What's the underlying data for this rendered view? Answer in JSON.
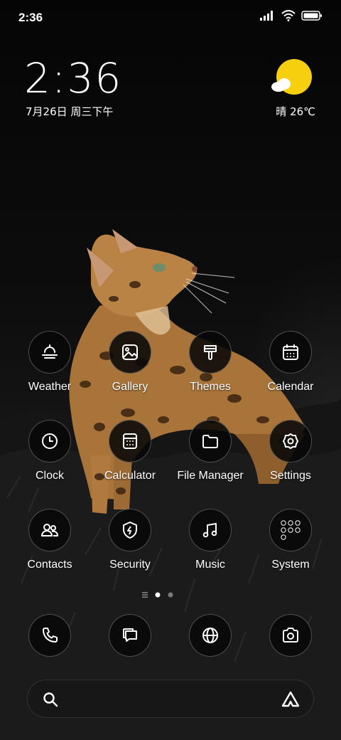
{
  "status_bar": {
    "time": "2:36",
    "icons": [
      "signal-icon",
      "wifi-icon",
      "battery-icon"
    ]
  },
  "clock_widget": {
    "time": "2:36",
    "date": "7月26日 周三下午"
  },
  "weather_widget": {
    "condition": "晴",
    "temperature": "26℃",
    "icon": "sun-cloud-icon"
  },
  "apps": [
    {
      "label": "Weather",
      "icon": "weather-icon"
    },
    {
      "label": "Gallery",
      "icon": "gallery-icon"
    },
    {
      "label": "Themes",
      "icon": "themes-brush-icon"
    },
    {
      "label": "Calendar",
      "icon": "calendar-icon"
    },
    {
      "label": "Clock",
      "icon": "clock-icon"
    },
    {
      "label": "Calculator",
      "icon": "calculator-icon"
    },
    {
      "label": "File Manager",
      "icon": "folder-icon"
    },
    {
      "label": "Settings",
      "icon": "gear-icon"
    },
    {
      "label": "Contacts",
      "icon": "contacts-icon"
    },
    {
      "label": "Security",
      "icon": "shield-icon"
    },
    {
      "label": "Music",
      "icon": "music-note-icon"
    },
    {
      "label": "System",
      "icon": "folder-grid-icon"
    }
  ],
  "page_indicator": {
    "pages": 2,
    "current": 1
  },
  "dock": [
    {
      "name": "phone",
      "icon": "phone-icon"
    },
    {
      "name": "messages",
      "icon": "message-icon"
    },
    {
      "name": "browser",
      "icon": "globe-icon"
    },
    {
      "name": "camera",
      "icon": "camera-icon"
    }
  ],
  "search_bar": {
    "left_icon": "search-icon",
    "right_icon": "assistant-icon"
  },
  "colors": {
    "sun": "#F6CF0F",
    "icon_bg": "#0a0a0a",
    "text": "#FFFFFF"
  }
}
